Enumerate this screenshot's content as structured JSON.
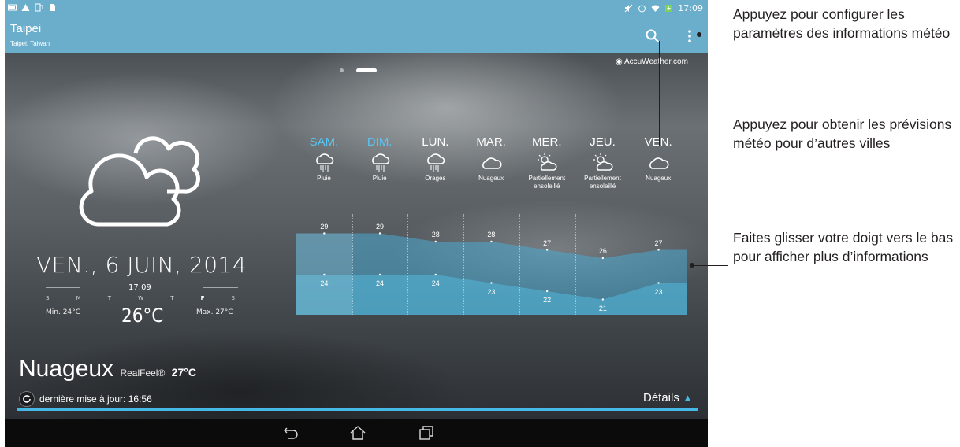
{
  "status_bar": {
    "time": "17:09"
  },
  "action_bar": {
    "city": "Taipei",
    "city_subtitle": "Taipei, Taiwan",
    "search_icon": "search-icon",
    "menu_icon": "overflow-menu-icon"
  },
  "branding": "AccuWeather.com",
  "current": {
    "date": "VEN., 6 JUIN, 2014",
    "time": "17:09",
    "weekdays": [
      "S",
      "M",
      "T",
      "W",
      "T",
      "F",
      "S"
    ],
    "min": "Min. 24°C",
    "max": "Max. 27°C",
    "temp": "26°C",
    "condition": "Nuageux",
    "realfeel_label": "RealFeel®",
    "realfeel_value": "27°C",
    "last_update": "dernière mise à jour: 16:56",
    "details_label": "Détails"
  },
  "forecast": [
    {
      "day": "SAM.",
      "cond": "Pluie",
      "icon": "rain-icon",
      "high": 29,
      "low": 24,
      "highlight": true
    },
    {
      "day": "DIM.",
      "cond": "Pluie",
      "icon": "rain-icon",
      "high": 29,
      "low": 24,
      "highlight": true
    },
    {
      "day": "LUN.",
      "cond": "Orages",
      "icon": "storm-icon",
      "high": 28,
      "low": 24,
      "highlight": false
    },
    {
      "day": "MAR.",
      "cond": "Nuageux",
      "icon": "cloud-icon",
      "high": 28,
      "low": 23,
      "highlight": false
    },
    {
      "day": "MER.",
      "cond": "Partiellement ensoleillé",
      "icon": "partly-sunny-icon",
      "high": 27,
      "low": 22,
      "highlight": false
    },
    {
      "day": "JEU.",
      "cond": "Partiellement ensoleillé",
      "icon": "partly-sunny-icon",
      "high": 26,
      "low": 21,
      "highlight": false
    },
    {
      "day": "VEN.",
      "cond": "Nuageux",
      "icon": "cloud-icon",
      "high": 27,
      "low": 23,
      "highlight": false
    }
  ],
  "annotations": [
    "Appuyez pour configurer les paramètres des informations météo",
    "Appuyez pour obtenir les prévisions météo pour d’autres villes",
    "Faites glisser votre doigt vers le bas pour afficher plus d’informations"
  ],
  "colors": {
    "action_bar": "#6aaecc",
    "accent": "#45b8e6",
    "highlight_day": "#59c5f0"
  }
}
